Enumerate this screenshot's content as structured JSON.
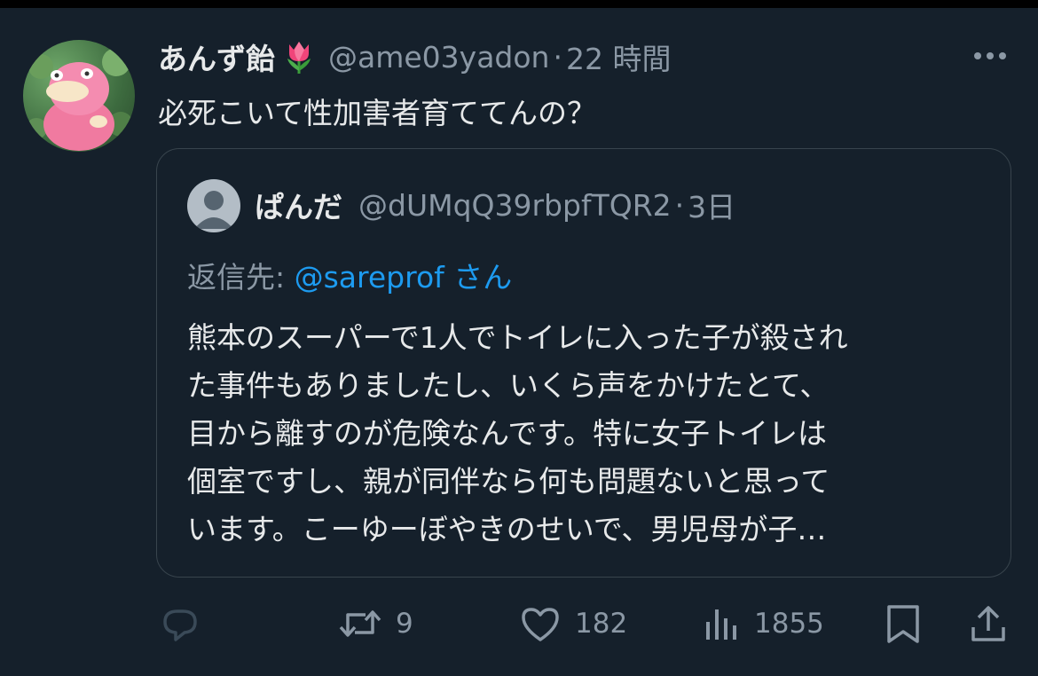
{
  "tweet": {
    "display_name": "あんず飴",
    "name_emoji": "tulip-emoji",
    "handle": "@ame03yadon",
    "separator": "·",
    "time": "22 時間",
    "text": "必死こいて性加害者育ててんの？",
    "more_icon": "more-icon"
  },
  "quote": {
    "display_name": "ぱんだ",
    "handle": "@dUMqQ39rbpfTQR2",
    "separator": "·",
    "time": "3日",
    "reply_prefix": "返信先: ",
    "reply_mention": "@sareprof",
    "reply_suffix": " さん",
    "body_lines": [
      "熊本のスーパーで1人でトイレに入った子が殺され",
      "た事件もありましたし、いくら声をかけたとて、",
      "目から離すのが危険なんです。特に女子トイレは",
      "個室ですし、親が同伴なら何も問題ないと思って",
      "います。こーゆーぼやきのせいで、男児母が子…"
    ]
  },
  "actions": {
    "reply": {
      "icon": "reply-icon",
      "count": ""
    },
    "retweet": {
      "icon": "retweet-icon",
      "count": "9"
    },
    "like": {
      "icon": "heart-icon",
      "count": "182"
    },
    "views": {
      "icon": "views-icon",
      "count": "1855"
    },
    "bookmark": {
      "icon": "bookmark-icon"
    },
    "share": {
      "icon": "share-icon"
    }
  },
  "colors": {
    "background": "#15202b",
    "text": "#e7e9ea",
    "muted": "#8b98a5",
    "link": "#1d9bf0",
    "border": "#38444d"
  }
}
